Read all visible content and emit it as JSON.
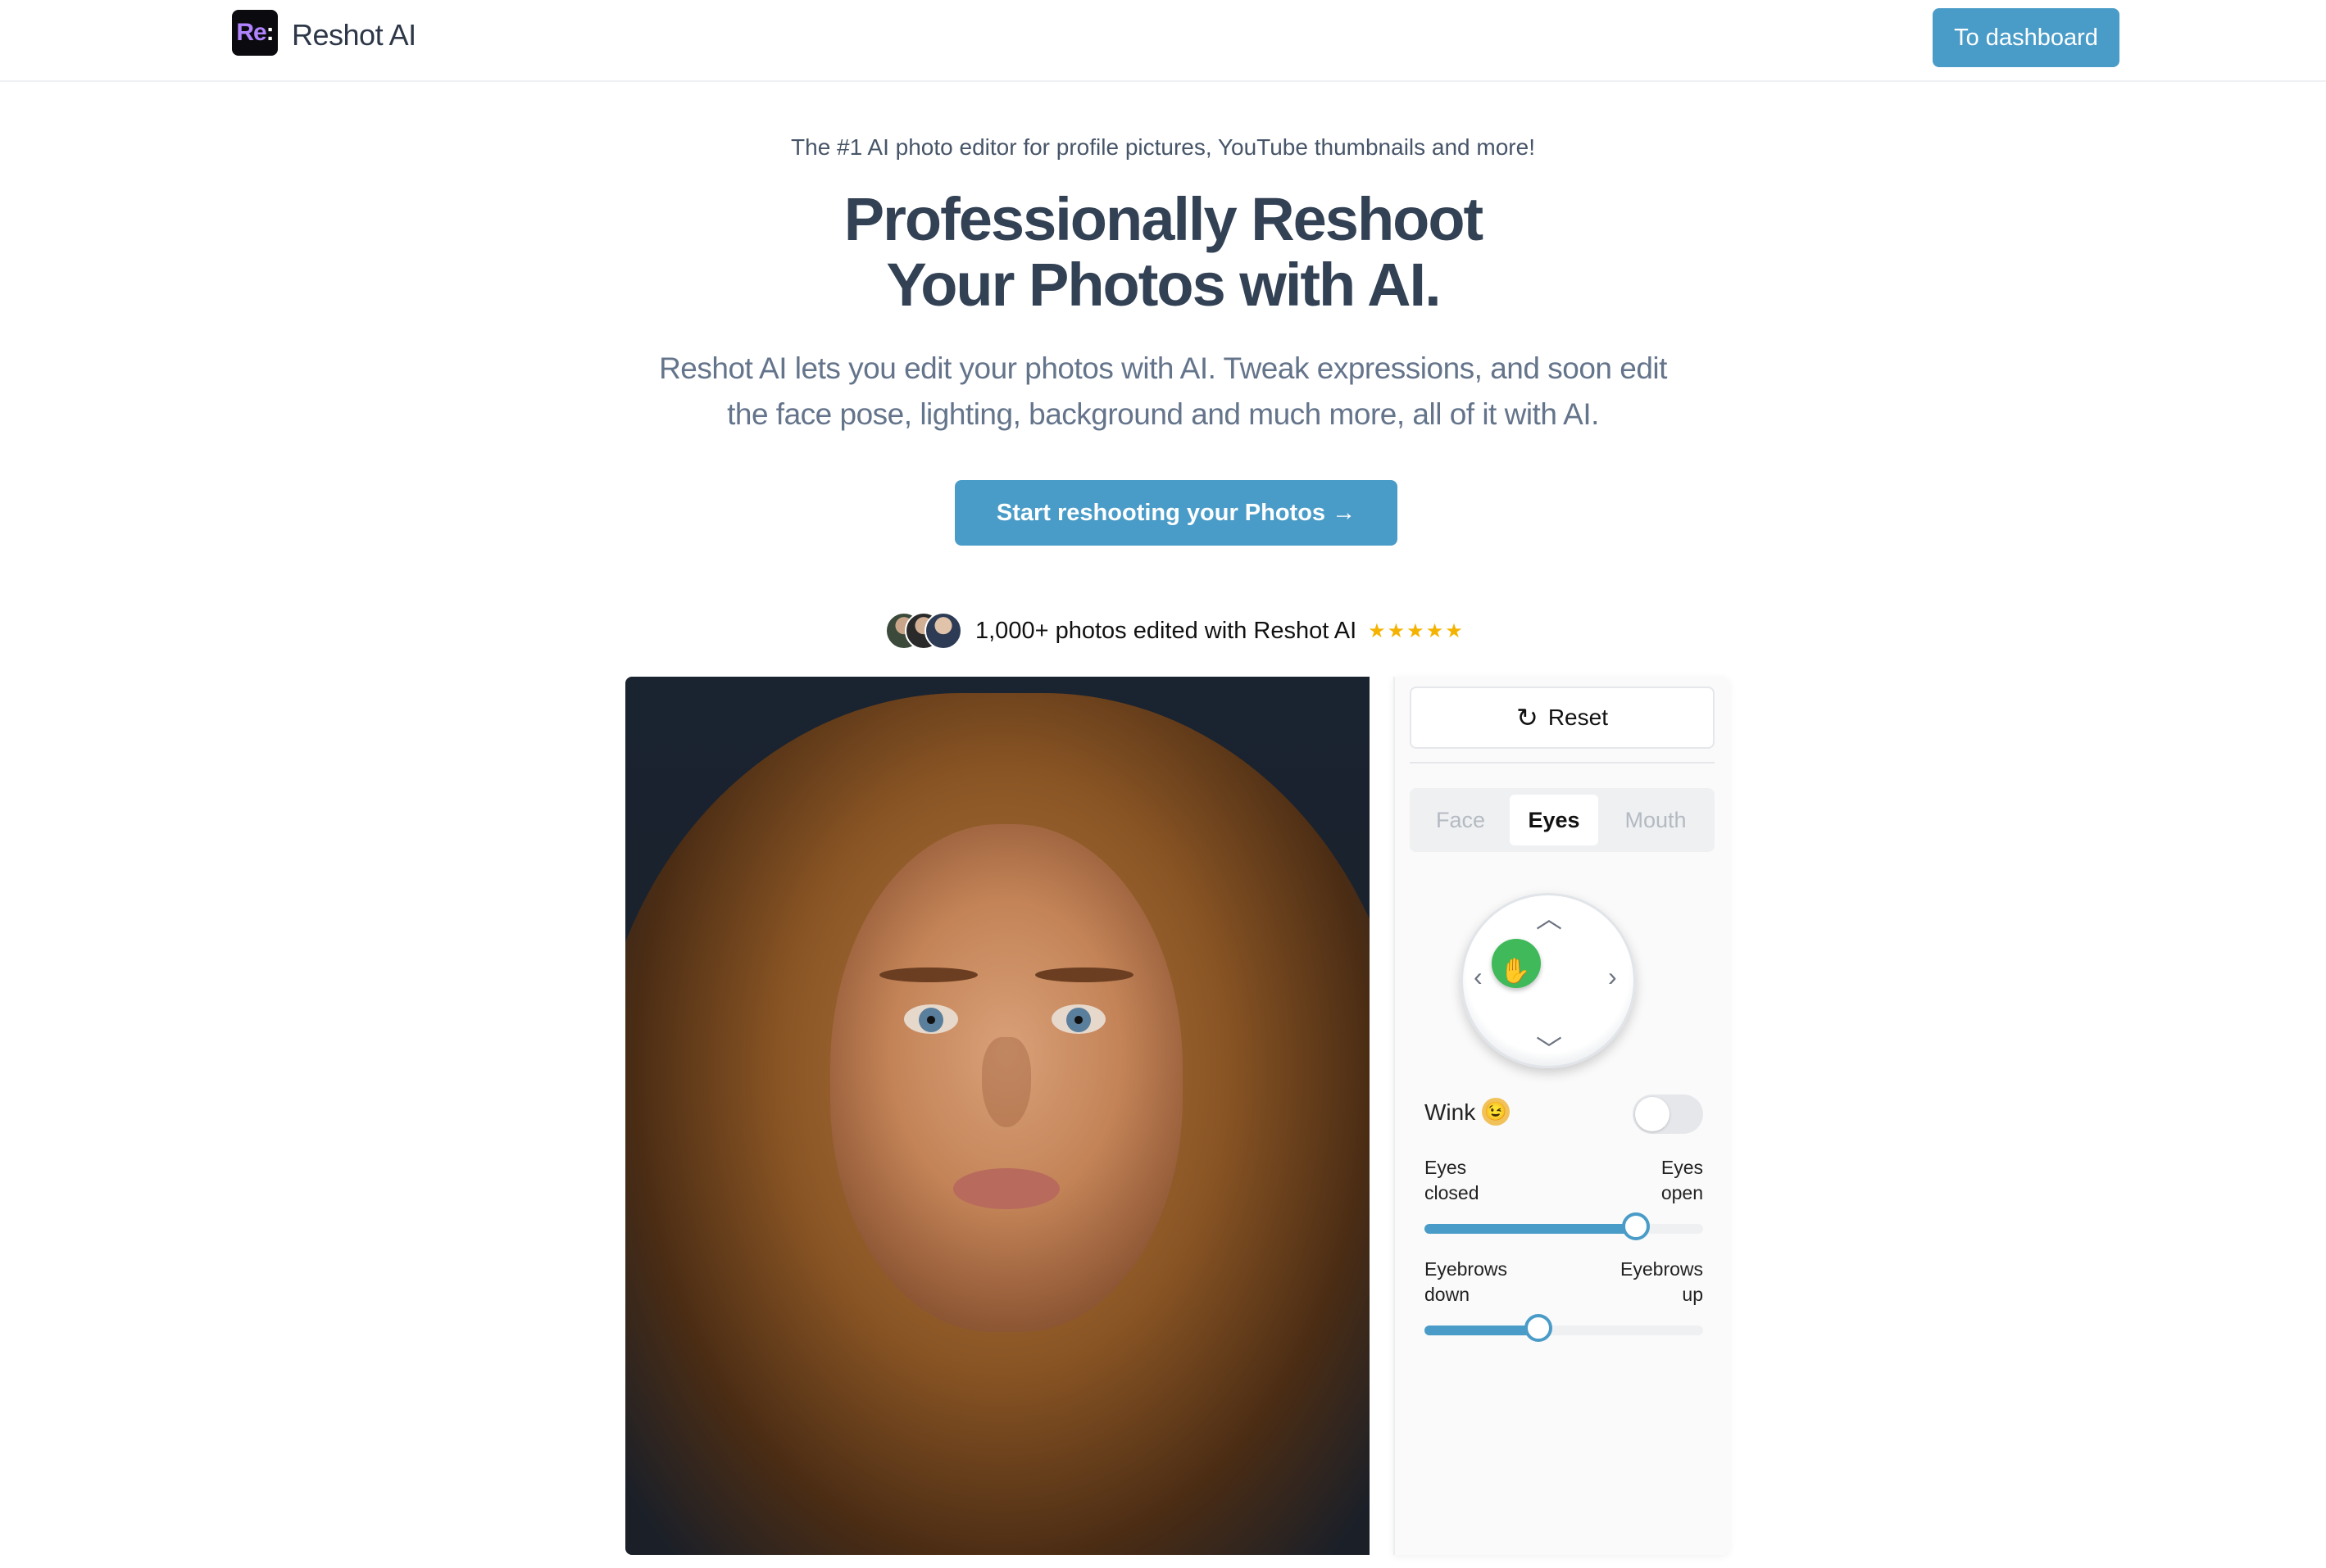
{
  "nav": {
    "logo_text": "Re",
    "logo_colon": ":",
    "brand": "Reshot AI",
    "dashboard_label": "To dashboard"
  },
  "hero": {
    "tagline": "The #1 AI photo editor for profile pictures, YouTube thumbnails and more!",
    "headline_line1": "Professionally Reshoot",
    "headline_line2": "Your Photos with AI.",
    "subhead": "Reshot AI lets you edit your photos with AI. Tweak expressions, and soon edit the face pose, lighting, background and much more, all of it with AI.",
    "cta_label": "Start reshooting your Photos →"
  },
  "social": {
    "text": "1,000+ photos edited with Reshot AI",
    "stars": "★★★★★",
    "rating": 5
  },
  "editor": {
    "reset_icon": "↻",
    "reset_label": "Reset",
    "tabs": [
      {
        "label": "Face",
        "active": false
      },
      {
        "label": "Eyes",
        "active": true
      },
      {
        "label": "Mouth",
        "active": false
      }
    ],
    "joystick": {
      "up": "︿",
      "down": "﹀",
      "left": "‹",
      "right": "›",
      "hand": "✋"
    },
    "wink_label": "Wink",
    "wink_emoji": "😉",
    "wink_on": false,
    "sliders": [
      {
        "left_label_1": "Eyes",
        "left_label_2": "closed",
        "right_label_1": "Eyes",
        "right_label_2": "open",
        "value": 0.76
      },
      {
        "left_label_1": "Eyebrows",
        "left_label_2": "down",
        "right_label_1": "Eyebrows",
        "right_label_2": "up",
        "value": 0.41
      }
    ]
  },
  "colors": {
    "accent": "#4a9cc8",
    "text_dark": "#334155",
    "text_muted": "#64748b",
    "star": "#f5b301",
    "knob": "#3fb95a"
  }
}
